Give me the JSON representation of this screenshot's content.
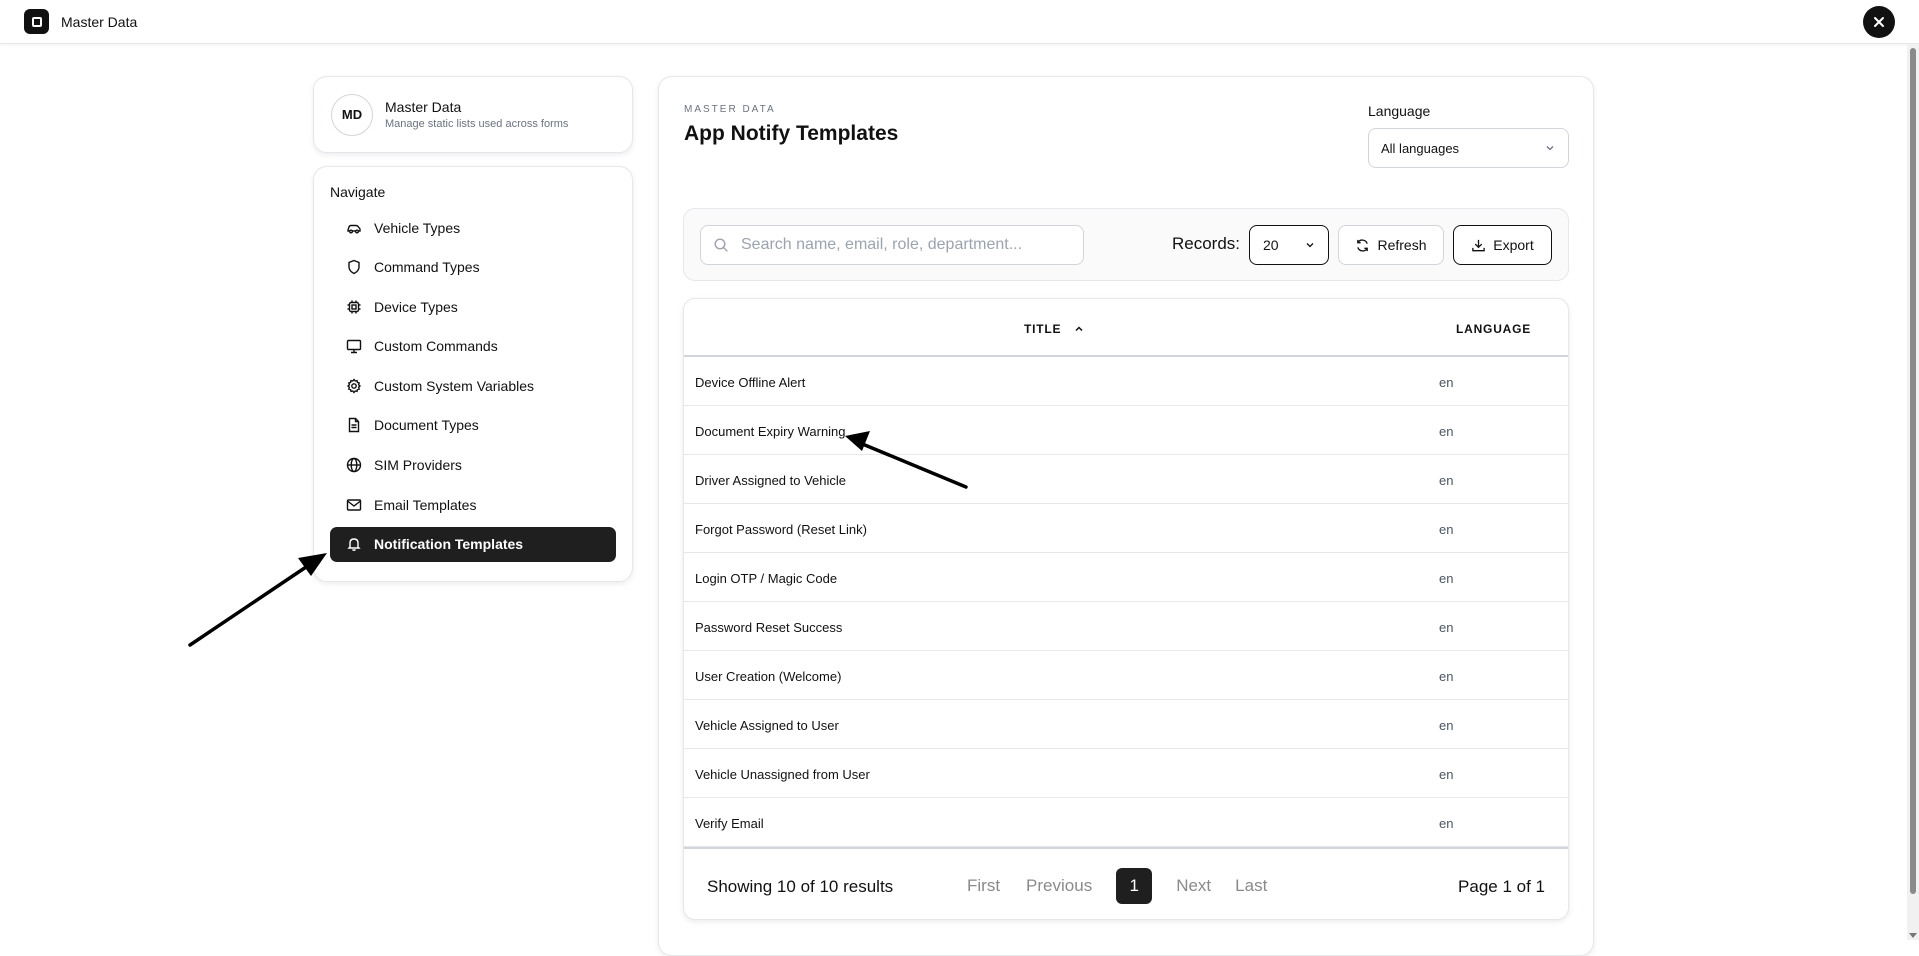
{
  "window": {
    "title": "Master Data"
  },
  "sidebar": {
    "profile": {
      "initials": "MD",
      "title": "Master Data",
      "subtitle": "Manage static lists used across forms"
    },
    "nav_heading": "Navigate",
    "items": [
      {
        "label": "Vehicle Types",
        "icon": "car-icon"
      },
      {
        "label": "Command Types",
        "icon": "shield-icon"
      },
      {
        "label": "Device Types",
        "icon": "chip-icon"
      },
      {
        "label": "Custom Commands",
        "icon": "monitor-icon"
      },
      {
        "label": "Custom System Variables",
        "icon": "gear-icon"
      },
      {
        "label": "Document Types",
        "icon": "document-icon"
      },
      {
        "label": "SIM Providers",
        "icon": "globe-icon"
      },
      {
        "label": "Email Templates",
        "icon": "mail-icon"
      },
      {
        "label": "Notification Templates",
        "icon": "bell-icon",
        "active": true
      }
    ]
  },
  "main": {
    "eyebrow": "MASTER DATA",
    "title": "App Notify Templates",
    "language": {
      "label": "Language",
      "value": "All languages"
    },
    "toolbar": {
      "search_placeholder": "Search name, email, role, department...",
      "records_label": "Records:",
      "records_value": "20",
      "refresh_label": "Refresh",
      "export_label": "Export"
    },
    "table": {
      "columns": [
        "TITLE",
        "LANGUAGE"
      ],
      "rows": [
        {
          "title": "Device Offline Alert",
          "language": "en"
        },
        {
          "title": "Document Expiry Warning",
          "language": "en"
        },
        {
          "title": "Driver Assigned to Vehicle",
          "language": "en"
        },
        {
          "title": "Forgot Password (Reset Link)",
          "language": "en"
        },
        {
          "title": "Login OTP / Magic Code",
          "language": "en"
        },
        {
          "title": "Password Reset Success",
          "language": "en"
        },
        {
          "title": "User Creation (Welcome)",
          "language": "en"
        },
        {
          "title": "Vehicle Assigned to User",
          "language": "en"
        },
        {
          "title": "Vehicle Unassigned from User",
          "language": "en"
        },
        {
          "title": "Verify Email",
          "language": "en"
        }
      ]
    },
    "pagination": {
      "showing": "Showing 10 of 10 results",
      "first": "First",
      "previous": "Previous",
      "current": "1",
      "next": "Next",
      "last": "Last",
      "page_of": "Page 1 of 1"
    }
  },
  "colors": {
    "accent": "#1f1f1f",
    "border": "#e5e7eb",
    "muted": "#6b7280"
  }
}
